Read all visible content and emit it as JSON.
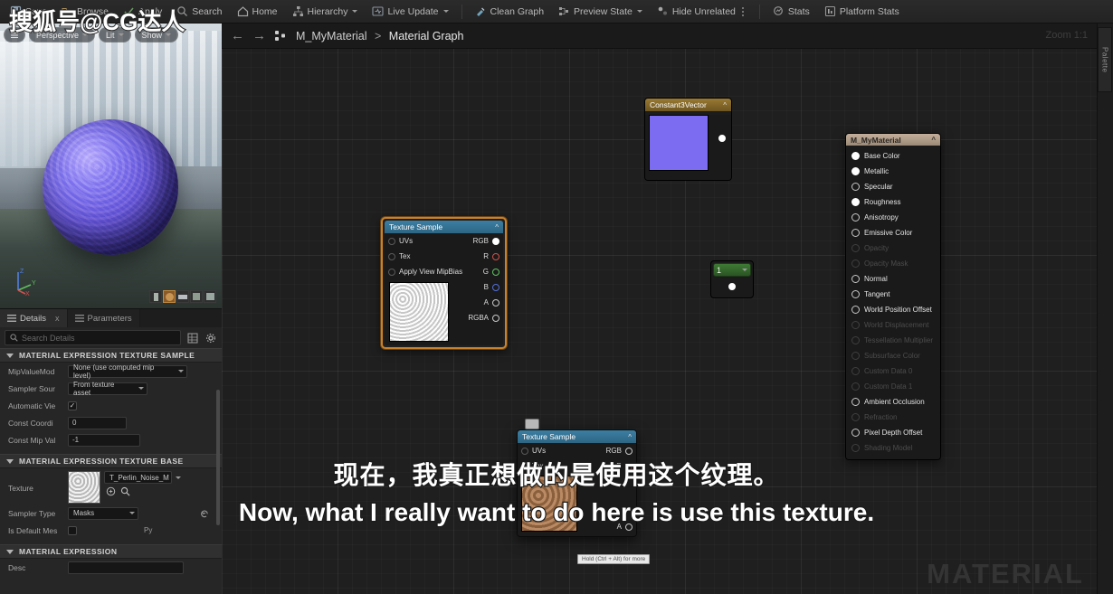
{
  "toolbar": {
    "items": [
      {
        "label": "Save",
        "icon": "save-icon"
      },
      {
        "label": "Browse",
        "icon": "browse-icon"
      },
      {
        "label": "Apply",
        "icon": "apply-icon"
      },
      {
        "label": "Search",
        "icon": "search-icon"
      },
      {
        "label": "Home",
        "icon": "home-icon"
      },
      {
        "label": "Hierarchy",
        "icon": "hierarchy-icon"
      },
      {
        "label": "Live Update",
        "icon": "live-update-icon"
      },
      {
        "label": "Clean Graph",
        "icon": "clean-graph-icon"
      },
      {
        "label": "Preview State",
        "icon": "preview-state-icon"
      },
      {
        "label": "Hide Unrelated",
        "icon": "hide-unrelated-icon"
      },
      {
        "label": "Stats",
        "icon": "stats-icon"
      },
      {
        "label": "Platform Stats",
        "icon": "platform-stats-icon"
      }
    ]
  },
  "viewport": {
    "perspective_label": "Perspective",
    "lit_label": "Lit",
    "show_label": "Show",
    "axis_labels": {
      "z": "Z",
      "y": "Y",
      "x": "X"
    },
    "preview_shapes": [
      "cylinder-shape",
      "sphere-shape",
      "plane-shape",
      "cube-shape",
      "custom-mesh-shape"
    ],
    "selected_shape_index": 1
  },
  "details": {
    "tab_details": "Details",
    "tab_parameters": "Parameters",
    "close_label": "x",
    "search_placeholder": "Search Details",
    "categories": [
      {
        "title": "MATERIAL EXPRESSION TEXTURE SAMPLE",
        "rows": [
          {
            "label": "MipValueMod",
            "type": "combo",
            "value": "None (use computed mip level)"
          },
          {
            "label": "Sampler Sour",
            "type": "combo",
            "value": "From texture asset"
          },
          {
            "label": "Automatic Vie",
            "type": "checkbox",
            "value": "✓"
          },
          {
            "label": "Const Coordi",
            "type": "field",
            "value": "0"
          },
          {
            "label": "Const Mip Val",
            "type": "field",
            "value": "-1"
          }
        ]
      },
      {
        "title": "MATERIAL EXPRESSION TEXTURE BASE",
        "rows": [
          {
            "label": "Texture",
            "type": "texture",
            "value": "T_Perlin_Noise_M"
          },
          {
            "label": "Sampler Type",
            "type": "combo",
            "value": "Masks"
          },
          {
            "label": "Is Default Mes",
            "type": "checkbox",
            "value": ""
          }
        ]
      },
      {
        "title": "MATERIAL EXPRESSION",
        "rows": [
          {
            "label": "Desc",
            "type": "field",
            "value": ""
          }
        ]
      }
    ],
    "py_label": "Py"
  },
  "graph": {
    "back_arrow": "←",
    "forward_arrow": "→",
    "breadcrumb_root": "M_MyMaterial",
    "breadcrumb_sep": ">",
    "breadcrumb_leaf": "Material Graph",
    "zoom_label": "Zoom 1:1",
    "watermark": "MATERIAL"
  },
  "nodes": {
    "texture_sample": {
      "title": "Texture Sample",
      "inputs": [
        "UVs",
        "Tex",
        "Apply View MipBias"
      ],
      "outputs": [
        {
          "label": "RGB",
          "color": "white"
        },
        {
          "label": "R",
          "color": "r"
        },
        {
          "label": "G",
          "color": "g"
        },
        {
          "label": "B",
          "color": "b"
        },
        {
          "label": "A",
          "color": "white"
        },
        {
          "label": "RGBA",
          "color": "white"
        }
      ]
    },
    "constant_vector": {
      "title": "Constant3Vector",
      "color_hex": "#7b6cf2"
    },
    "scalar": {
      "title": "1"
    },
    "material_output": {
      "title": "M_MyMaterial",
      "pins": [
        {
          "label": "Base Color",
          "enabled": true,
          "connected": true
        },
        {
          "label": "Metallic",
          "enabled": true,
          "connected": true
        },
        {
          "label": "Specular",
          "enabled": true,
          "connected": false
        },
        {
          "label": "Roughness",
          "enabled": true,
          "connected": true
        },
        {
          "label": "Anisotropy",
          "enabled": true,
          "connected": false
        },
        {
          "label": "Emissive Color",
          "enabled": true,
          "connected": false
        },
        {
          "label": "Opacity",
          "enabled": false,
          "connected": false
        },
        {
          "label": "Opacity Mask",
          "enabled": false,
          "connected": false
        },
        {
          "label": "Normal",
          "enabled": true,
          "connected": false
        },
        {
          "label": "Tangent",
          "enabled": true,
          "connected": false
        },
        {
          "label": "World Position Offset",
          "enabled": true,
          "connected": false
        },
        {
          "label": "World Displacement",
          "enabled": false,
          "connected": false
        },
        {
          "label": "Tessellation Multiplier",
          "enabled": false,
          "connected": false
        },
        {
          "label": "Subsurface Color",
          "enabled": false,
          "connected": false
        },
        {
          "label": "Custom Data 0",
          "enabled": false,
          "connected": false
        },
        {
          "label": "Custom Data 1",
          "enabled": false,
          "connected": false
        },
        {
          "label": "Ambient Occlusion",
          "enabled": true,
          "connected": false
        },
        {
          "label": "Refraction",
          "enabled": false,
          "connected": false
        },
        {
          "label": "Pixel Depth Offset",
          "enabled": true,
          "connected": false
        },
        {
          "label": "Shading Model",
          "enabled": false,
          "connected": false
        }
      ]
    },
    "dragged_texture_sample": {
      "title": "Texture Sample",
      "inputs": [
        "UVs",
        "Tex"
      ],
      "outputs": [
        {
          "label": "RGB",
          "color": "white"
        },
        {
          "label": "R",
          "color": "r"
        },
        {
          "label": "A",
          "color": "white"
        }
      ],
      "tooltip": "Hold (Ctrl + Alt) for more"
    }
  },
  "palette": {
    "tab_label": "Palette"
  },
  "subtitles": {
    "chinese": "现在，我真正想做的是使用这个纹理。",
    "english": "Now, what I really want to do here is use this texture."
  },
  "channel_watermark": "搜狐号@CG达人"
}
